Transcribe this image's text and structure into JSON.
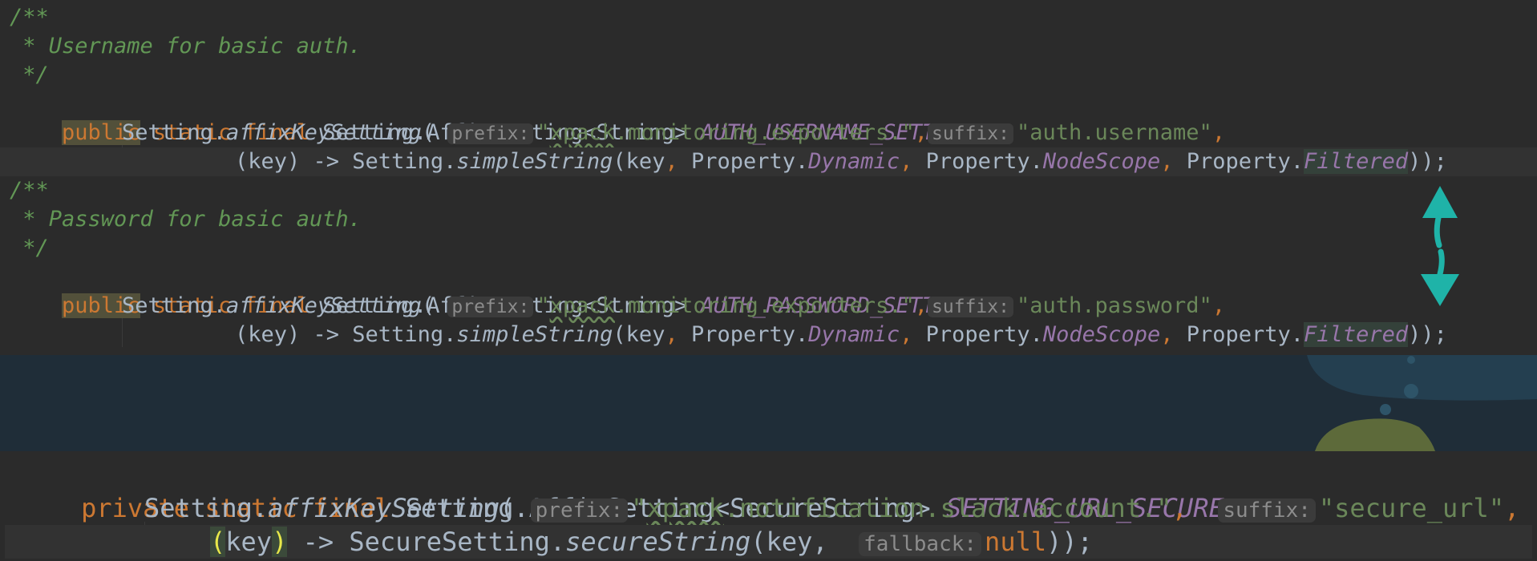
{
  "top": {
    "comment1": [
      "/**",
      " * Username for basic auth.",
      " */"
    ],
    "decl1": {
      "modifier": "public",
      "keywords": "static final",
      "type": "Setting.AffixSetting<String>",
      "name": "AUTH_USERNAME_SETTING",
      "assign": " ="
    },
    "call1": {
      "prefix_obj": "Setting.",
      "method": "affixKeySetting",
      "open": "(",
      "hint_prefix": "prefix:",
      "prefix_value": "\"xpack.monitoring.exporters.\"",
      "comma": ",",
      "hint_suffix": "suffix:",
      "suffix_value": "\"auth.username\"",
      "end": ","
    },
    "lambda1": {
      "lhs": "(key) -> Setting.",
      "method": "simpleString",
      "args_a": "(key",
      "sep": ", ",
      "prop": "Property.",
      "p1": "Dynamic",
      "p2": "NodeScope",
      "p3": "Filtered",
      "end": "));"
    },
    "comment2": [
      "/**",
      " * Password for basic auth.",
      " */"
    ],
    "decl2": {
      "modifier": "public",
      "keywords": "static final",
      "type": "Setting.AffixSetting<String>",
      "name": "AUTH_PASSWORD_SETTING",
      "assign": " ="
    },
    "call2": {
      "prefix_obj": "Setting.",
      "method": "affixKeySetting",
      "open": "(",
      "hint_prefix": "prefix:",
      "prefix_value": "\"xpack.monitoring.exporters.\"",
      "comma": ",",
      "hint_suffix": "suffix:",
      "suffix_value": "\"auth.password\"",
      "end": ","
    },
    "lambda2": {
      "lhs": "(key) -> Setting.",
      "method": "simpleString",
      "args_a": "(key",
      "sep": ", ",
      "prop": "Property.",
      "p1": "Dynamic",
      "p2": "NodeScope",
      "p3": "Filtered",
      "end": "));"
    }
  },
  "bottom": {
    "decl": {
      "modifier": "private",
      "keywords": "static final",
      "type": "Setting.AffixSetting<SecureString>",
      "name": "SETTING_URL_SECURE",
      "assign": " ="
    },
    "call": {
      "prefix_obj": "Setting.",
      "method": "affixKeySetting",
      "open": "(",
      "hint_prefix": "prefix:",
      "prefix_value": "\"xpack.notification.slack.account.\"",
      "comma": ",",
      "hint_suffix": "suffix:",
      "suffix_value": "\"secure_url\"",
      "end": ","
    },
    "lambda": {
      "paren_open": "(",
      "key": "key",
      "paren_close": ")",
      "arrow": " -> SecureSetting.",
      "method": "secureString",
      "args": "(key, ",
      "hint_fallback": "fallback:",
      "null_value": "null",
      "end": "));"
    }
  },
  "colors": {
    "background": "#2b2b2b",
    "keyword": "#cc7832",
    "comment": "#629755",
    "constant": "#9876aa",
    "string": "#6a8759",
    "arrow": "#1fb3a8"
  },
  "icons": [
    "double-arrow-icon"
  ]
}
